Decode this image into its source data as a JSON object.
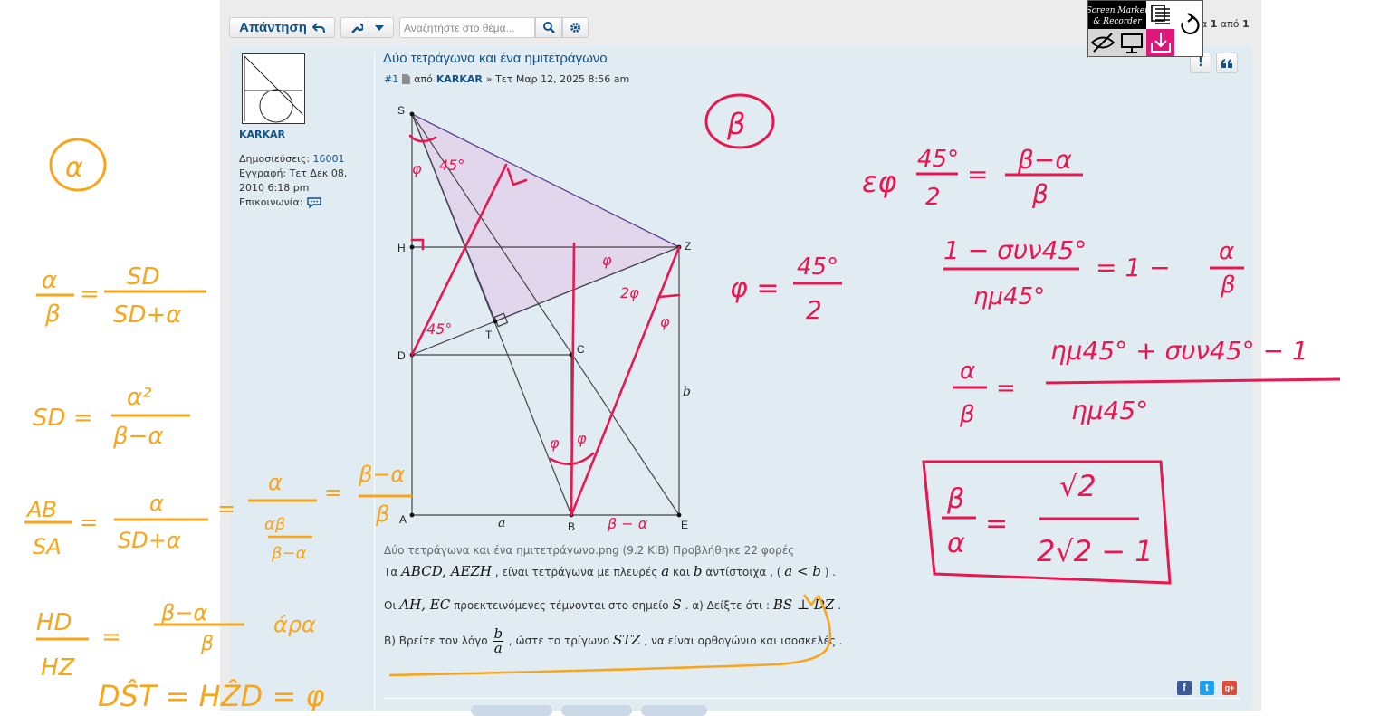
{
  "toolbar": {
    "reply_label": "Απάντηση",
    "search_placeholder": "Αναζητήστε στο θέμα..."
  },
  "pagination": {
    "current_page": "1",
    "of_label": "από",
    "total_pages": "1"
  },
  "screen_marker": {
    "logo_line1": "Screen Marker",
    "logo_line2": "& Recorder"
  },
  "post": {
    "title": "Δύο τετράγωνα και ένα ημιτετράγωνο",
    "number": "#1",
    "by_label": "από",
    "author": "KARKAR",
    "date": "» Τετ Μαρ 12, 2025 8:56 am",
    "attachment_caption": "Δύο τετράγωνα και ένα ημιτετράγωνο.png (9.2 KiB) Προβλήθηκε 22 φορές",
    "line1_a": "Τα",
    "line1_math1": "ABCD, AEZH",
    "line1_b": ", είναι τετράγωνα με πλευρές",
    "line1_math2": "a",
    "line1_c": "και",
    "line1_math3": "b",
    "line1_d": "αντίστοιχα , (",
    "line1_math4": "a < b",
    "line1_e": ") .",
    "line2_a": "Οι",
    "line2_math1": "AH, EC",
    "line2_b": "προεκτεινόμενες τέμνονται στο σημείο",
    "line2_math2": "S",
    "line2_c": ". α) Δείξτε ότι :",
    "line2_math3": "BS ⊥ DZ",
    "line2_d": ".",
    "line3_a": "Β) Βρείτε τον λόγο",
    "line3_num": "b",
    "line3_den": "a",
    "line3_b": ", ώστε το τρίγωνο",
    "line3_math": "STZ",
    "line3_c": ", να είναι ορθογώνιο και ισοσκελές ."
  },
  "profile": {
    "author": "KARKAR",
    "posts_label": "Δημοσιεύσεις:",
    "posts_value": "16001",
    "joined_label": "Εγγραφή:",
    "joined_value": "Τετ Δεκ 08, 2010 6:18 pm",
    "contact_label": "Επικοινωνία:"
  },
  "figure_labels": {
    "S": "S",
    "H": "H",
    "Z": "Z",
    "D": "D",
    "T": "T",
    "C": "C",
    "A": "A",
    "B": "B",
    "E": "E",
    "a": "a",
    "b": "b"
  },
  "annotations": {
    "orange_a": "α",
    "red_b": "β",
    "orange_eq1_lhs_num": "α",
    "orange_eq1_lhs_den": "β",
    "orange_eq1_rhs_num": "SD",
    "orange_eq1_rhs_den": "SD+α",
    "orange_eq2_lhs": "SD =",
    "orange_eq2_num": "α²",
    "orange_eq2_den": "β−α",
    "orange_eq3_lhs_num": "AB",
    "orange_eq3_lhs_den": "SA",
    "orange_eq3_m1_num": "α",
    "orange_eq3_m1_den": "SD+α",
    "orange_eq3_m2_num": "α",
    "orange_eq3_m2_den": "αβ / β−α",
    "orange_eq3_rhs_num": "β−α",
    "orange_eq3_rhs_den": "β",
    "orange_eq4_lhs_num": "HD",
    "orange_eq4_lhs_den": "HZ",
    "orange_eq4_rhs_num": "β−α",
    "orange_eq4_rhs_den": "β",
    "orange_eq4_note": "άρα",
    "orange_eq5": "DŜT = HẐD = φ",
    "red_eq1_lhs": "εφ",
    "red_eq1_angle_num": "45°",
    "red_eq1_angle_den": "2",
    "red_eq1_rhs_num": "β−α",
    "red_eq1_rhs_den": "β",
    "red_phi": "φ =",
    "red_phi_num": "45°",
    "red_phi_den": "2",
    "red_eq2_num": "1 − συν45°",
    "red_eq2_den": "ημ45°",
    "red_eq2_rhs": "= 1 −",
    "red_eq2_rhs_num": "α",
    "red_eq2_rhs_den": "β",
    "red_eq3_lhs_num": "α",
    "red_eq3_lhs_den": "β",
    "red_eq3_num": "ημ45° + συν45° − 1",
    "red_eq3_den": "ημ45°",
    "red_result_lhs_num": "β",
    "red_result_lhs_den": "α",
    "red_result_num": "√2",
    "red_result_den": "2√2 − 1",
    "fig_phi": "φ",
    "fig_45": "45°",
    "fig_2phi": "2φ",
    "fig_b_minus_a": "β − α"
  },
  "colors": {
    "link": "#105289",
    "post_bg": "#e1ebf2",
    "page_bg": "#ececec",
    "orange_ink": "#f7a61c",
    "red_ink": "#e8174f",
    "triangle_fill": "#e2d6ec",
    "triangle_stroke": "#5a3f8a"
  },
  "icons": [
    "reply-arrow-icon",
    "wrench-icon",
    "chevron-down-icon",
    "search-icon",
    "gear-icon",
    "report-icon",
    "quote-icon",
    "contact-icon",
    "facebook-icon",
    "twitter-icon",
    "google-plus-icon",
    "file-icon",
    "hide-icon",
    "monitor-icon",
    "save-icon",
    "undo-icon"
  ]
}
